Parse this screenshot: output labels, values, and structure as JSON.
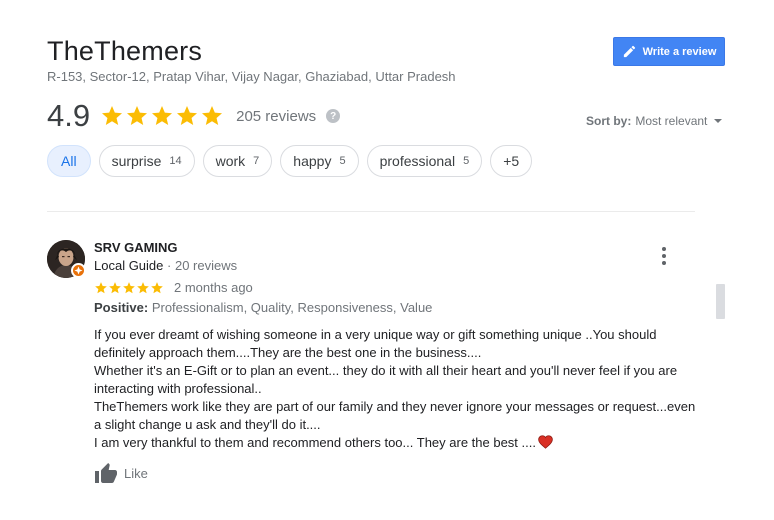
{
  "business": {
    "name": "TheThemers",
    "address": "R-153, Sector-12, Pratap Vihar, Vijay Nagar, Ghaziabad, Uttar Pradesh"
  },
  "write_review": {
    "label": "Write a review",
    "icon": "pencil-icon"
  },
  "summary": {
    "rating": "4.9",
    "stars": 5,
    "reviews": "205 reviews",
    "star_color": "#fbbc04"
  },
  "sort": {
    "label": "Sort by:",
    "value": "Most relevant"
  },
  "filters": [
    {
      "label": "All",
      "count": ""
    },
    {
      "label": "surprise",
      "count": "14"
    },
    {
      "label": "work",
      "count": "7"
    },
    {
      "label": "happy",
      "count": "5"
    },
    {
      "label": "professional",
      "count": "5"
    },
    {
      "label": "+5",
      "count": ""
    }
  ],
  "review": {
    "author": "SRV GAMING",
    "guide": "Local Guide",
    "author_reviews": "20 reviews",
    "stars": 5,
    "date": "2 months ago",
    "positive_label": "Positive:",
    "positive_values": "Professionalism, Quality, Responsiveness, Value",
    "text": [
      "If you ever dreamt of wishing someone in a very unique way or gift something unique ..You should definitely approach them....They are the best one in the business....",
      "Whether it's an E-Gift or to plan an event... they do it with all their heart and you'll never feel if you are interacting with professional..",
      "TheThemers work like they are part of our family and they never ignore your messages or request...even a slight change u ask and they'll do it....",
      "I am very thankful to them and recommend others too... They are the best ...."
    ],
    "like_label": "Like"
  },
  "colors": {
    "accent": "#4285f4",
    "chip_active_bg": "#e8f0fe",
    "chip_active_text": "#1a73e8",
    "guide_badge": "#e8710a",
    "heart": "#d93025"
  }
}
